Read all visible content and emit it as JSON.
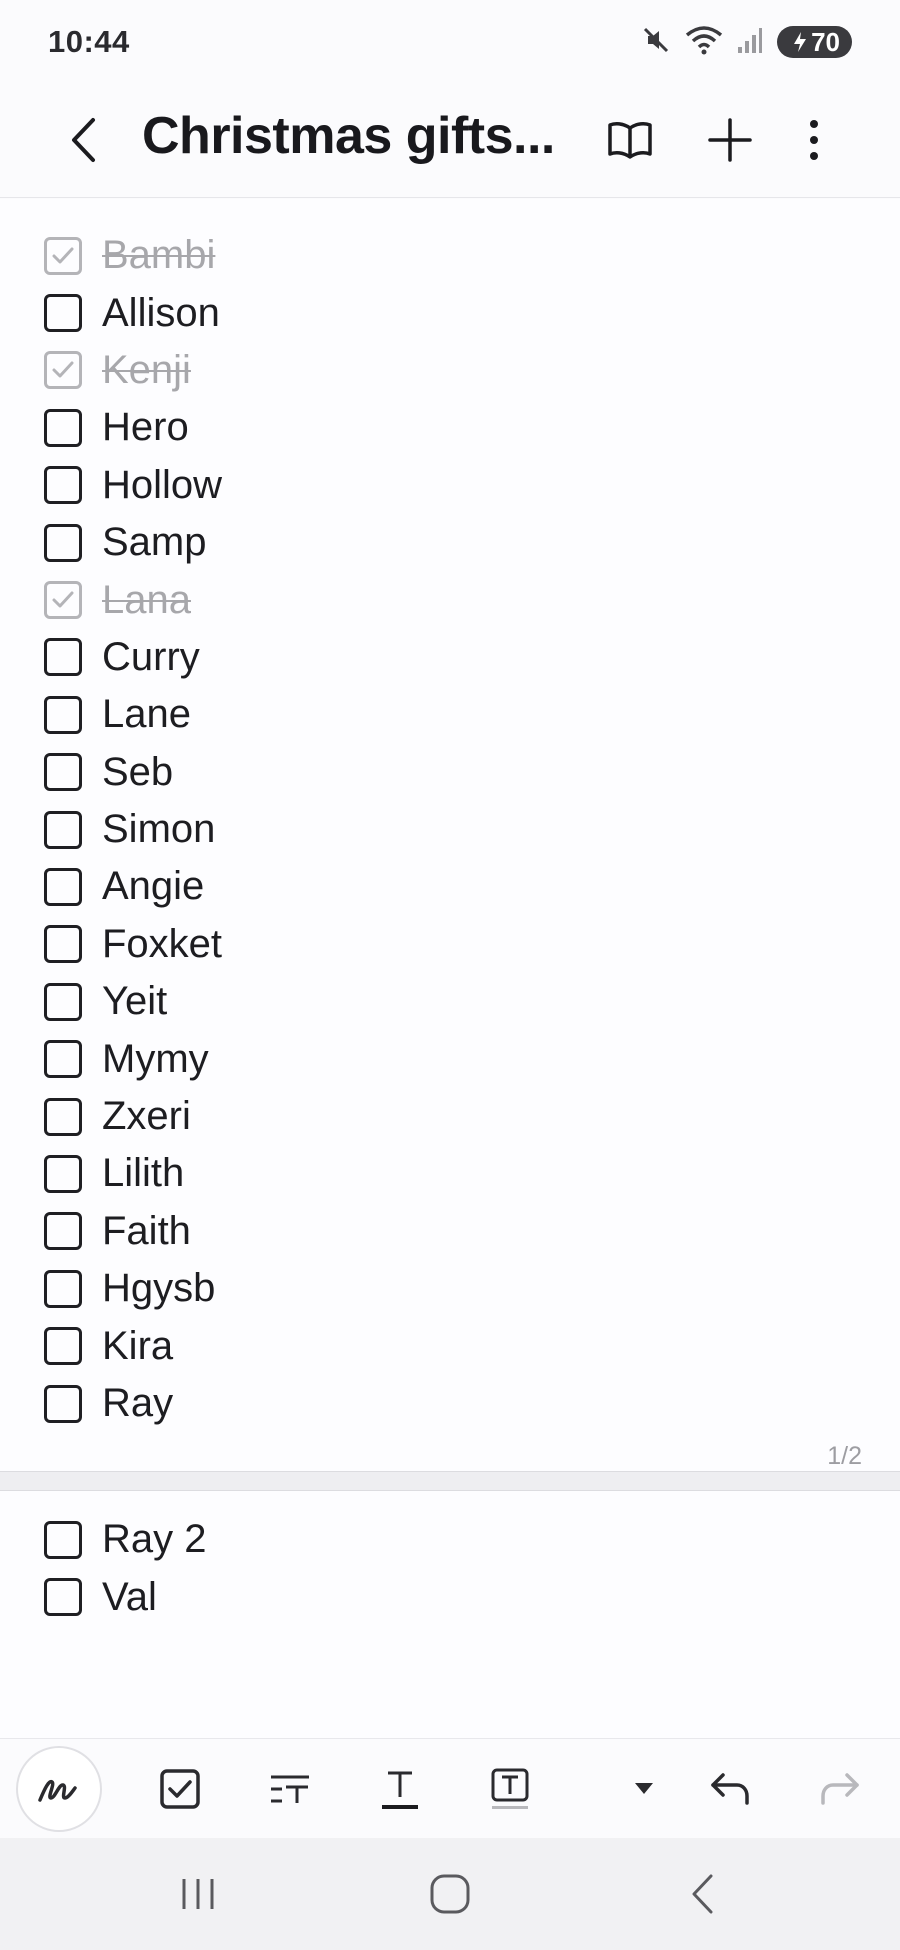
{
  "status_bar": {
    "time": "10:44",
    "battery_level": "70",
    "icons": [
      "mute-icon",
      "wifi-icon",
      "signal-icon",
      "battery-icon"
    ]
  },
  "app_bar": {
    "title": "Christmas gifts...",
    "icons": [
      "back-icon",
      "reading-mode-icon",
      "add-page-icon",
      "more-options-icon"
    ]
  },
  "page1": {
    "items": [
      {
        "label": "Bambi",
        "checked": true
      },
      {
        "label": "Allison",
        "checked": false
      },
      {
        "label": "Kenji",
        "checked": true
      },
      {
        "label": "Hero",
        "checked": false
      },
      {
        "label": "Hollow",
        "checked": false
      },
      {
        "label": "Samp",
        "checked": false
      },
      {
        "label": "Lana",
        "checked": true
      },
      {
        "label": "Curry",
        "checked": false
      },
      {
        "label": "Lane",
        "checked": false
      },
      {
        "label": "Seb",
        "checked": false
      },
      {
        "label": "Simon",
        "checked": false
      },
      {
        "label": "Angie",
        "checked": false
      },
      {
        "label": "Foxket",
        "checked": false
      },
      {
        "label": "Yeit",
        "checked": false
      },
      {
        "label": "Mymy",
        "checked": false
      },
      {
        "label": "Zxeri",
        "checked": false
      },
      {
        "label": "Lilith",
        "checked": false
      },
      {
        "label": "Faith",
        "checked": false
      },
      {
        "label": "Hgysb",
        "checked": false
      },
      {
        "label": "Kira",
        "checked": false
      },
      {
        "label": "Ray",
        "checked": false
      }
    ],
    "page_indicator": "1/2"
  },
  "page2": {
    "items": [
      {
        "label": "Ray 2",
        "checked": false
      },
      {
        "label": "Val",
        "checked": false
      }
    ]
  },
  "toolbar": {
    "tools": [
      "handwriting-pen-icon",
      "checkbox-tool-icon",
      "text-style-icon",
      "text-color-icon",
      "text-highlight-icon",
      "more-tools-dropdown-icon",
      "undo-icon",
      "redo-icon"
    ]
  },
  "nav_bar": {
    "buttons": [
      "recent-apps-icon",
      "home-icon",
      "system-back-icon"
    ]
  },
  "colors": {
    "checked_box": "#b4b4b8",
    "unchecked_box": "#1f1f23",
    "done_text": "#a7a7ab",
    "text": "#1d1d21"
  }
}
